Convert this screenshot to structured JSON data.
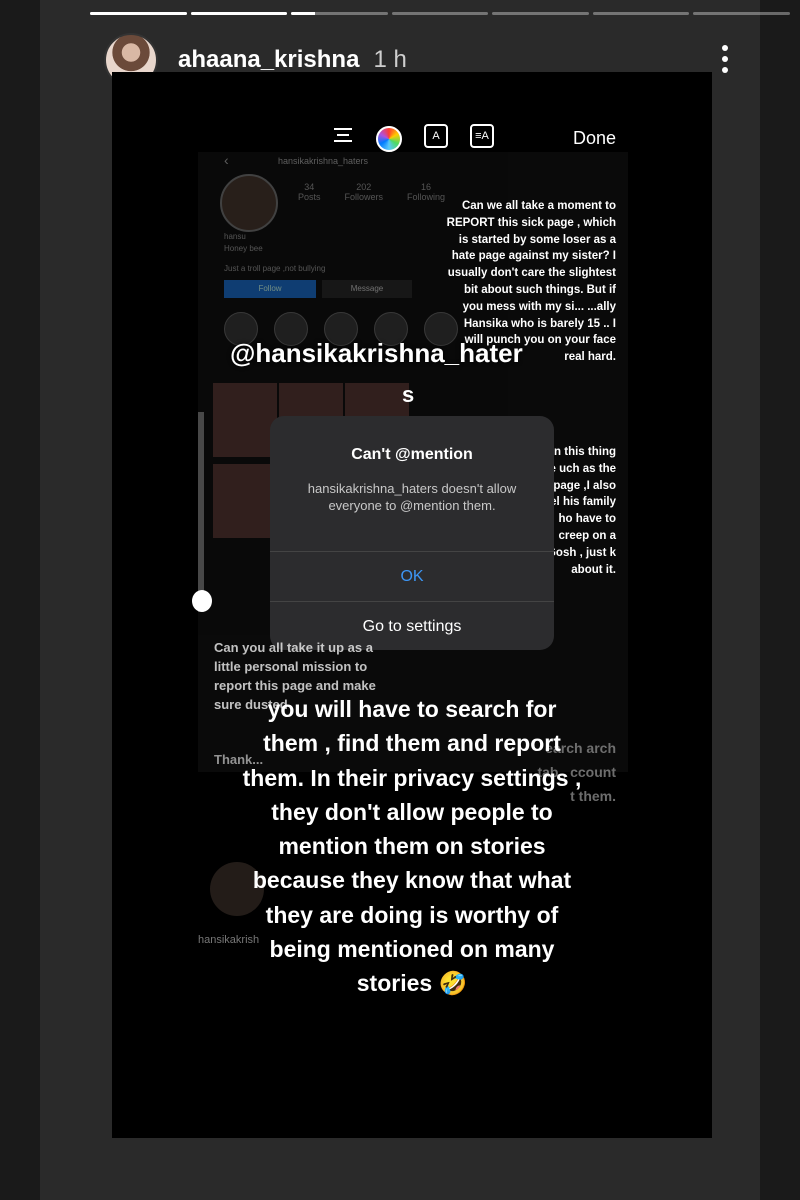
{
  "story": {
    "username": "ahaana_krishna",
    "time": "1 h",
    "progress": [
      1,
      1,
      0.25,
      0,
      0,
      0,
      0
    ]
  },
  "toolbar": {
    "done_label": "Done",
    "fx_label": "A",
    "fa_label": "≡A"
  },
  "screenshot": {
    "back_icon": "‹",
    "profile_name": "hansikakrishna_haters",
    "stats": [
      {
        "value": "34",
        "label": "Posts"
      },
      {
        "value": "202",
        "label": "Followers"
      },
      {
        "value": "16",
        "label": "Following"
      }
    ],
    "bio_name": "hansu",
    "bio_line": "Honey bee",
    "bio_desc": "Just a troll page ,not bullying",
    "follow_label": "Follow",
    "message_label": "Message"
  },
  "text_right": "Can we all take a moment to REPORT this sick page , which is started by some loser as a hate page against my sister? I usually don't care the slightest bit about such things. But if you mess with my si... ...ally Hansika who is barely 15 .. I will punch you on your face real hard.",
  "text_right2": "ent on this thing puke uch as the this page ,I also feel his family ho have to creep on a Gosh , just k about it.",
  "mention_tag": "@hansikakrishna_hater",
  "mention_trailing": "s",
  "dialog": {
    "title": "Can't @mention",
    "body": "hansikakrishna_haters doesn't allow everyone to @mention them.",
    "ok_label": "OK",
    "settings_label": "Go to settings"
  },
  "text_left": "Can you all take it up as a little personal mission to report this page and make sure dusted",
  "thanks": "Thank...",
  "ghost_text": "earch arch tab , ccount t them.",
  "caption": "you will have to search for them , find them and report them. In their privacy settings , they don't allow people to mention them on stories because they know that what they are doing is worthy of being mentioned on many stories 🤣",
  "small_name": "hansikakrish"
}
